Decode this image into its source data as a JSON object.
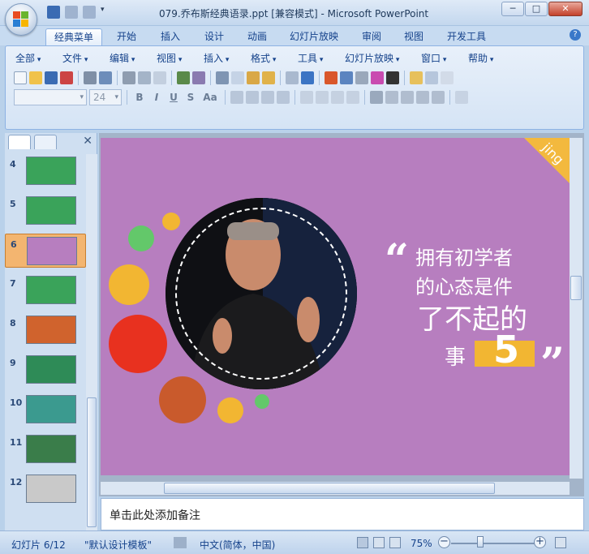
{
  "window": {
    "title": "079.乔布斯经典语录.ppt [兼容模式] - Microsoft PowerPoint",
    "btn_min": "─",
    "btn_max": "□",
    "btn_close": "✕"
  },
  "ribbon_tabs": [
    "经典菜单",
    "开始",
    "插入",
    "设计",
    "动画",
    "幻灯片放映",
    "审阅",
    "视图",
    "开发工具"
  ],
  "classic_menus": [
    "全部",
    "文件",
    "编辑",
    "视图",
    "插入",
    "格式",
    "工具",
    "幻灯片放映",
    "窗口",
    "帮助"
  ],
  "font": {
    "name_value": "",
    "size_value": "24"
  },
  "format_buttons": {
    "bold": "B",
    "italic": "I",
    "underline": "U",
    "strike": "S",
    "case": "Aa"
  },
  "help_label": "?",
  "left_pane": {
    "close_label": "✕",
    "slides": [
      {
        "num": "4",
        "color": "#3aa35a"
      },
      {
        "num": "5",
        "color": "#3aa35a"
      },
      {
        "num": "6",
        "color": "#b77ebf",
        "selected": true
      },
      {
        "num": "7",
        "color": "#3aa35a"
      },
      {
        "num": "8",
        "color": "#d0632d"
      },
      {
        "num": "9",
        "color": "#2e8b57"
      },
      {
        "num": "10",
        "color": "#3b9a8f"
      },
      {
        "num": "11",
        "color": "#3a7d4a"
      },
      {
        "num": "12",
        "color": "#c9c9c9"
      }
    ]
  },
  "slide": {
    "corner_text": "jing",
    "quote_open": "“",
    "quote_close": "”",
    "line1": "拥有初学者",
    "line2": "的心态是件",
    "line3": "了不起的",
    "line4": "事",
    "big_number": "5",
    "colors": {
      "background": "#b77ebf",
      "accent_yellow": "#f2b632",
      "red": "#e8311f",
      "orange": "#c95a2c",
      "green": "#63c86a"
    }
  },
  "notes": {
    "placeholder": "单击此处添加备注"
  },
  "status": {
    "slide_counter": "幻灯片 6/12",
    "theme": "\"默认设计模板\"",
    "language": "中文(简体，中国)",
    "zoom": "75%",
    "zoom_out": "−",
    "zoom_in": "+"
  }
}
